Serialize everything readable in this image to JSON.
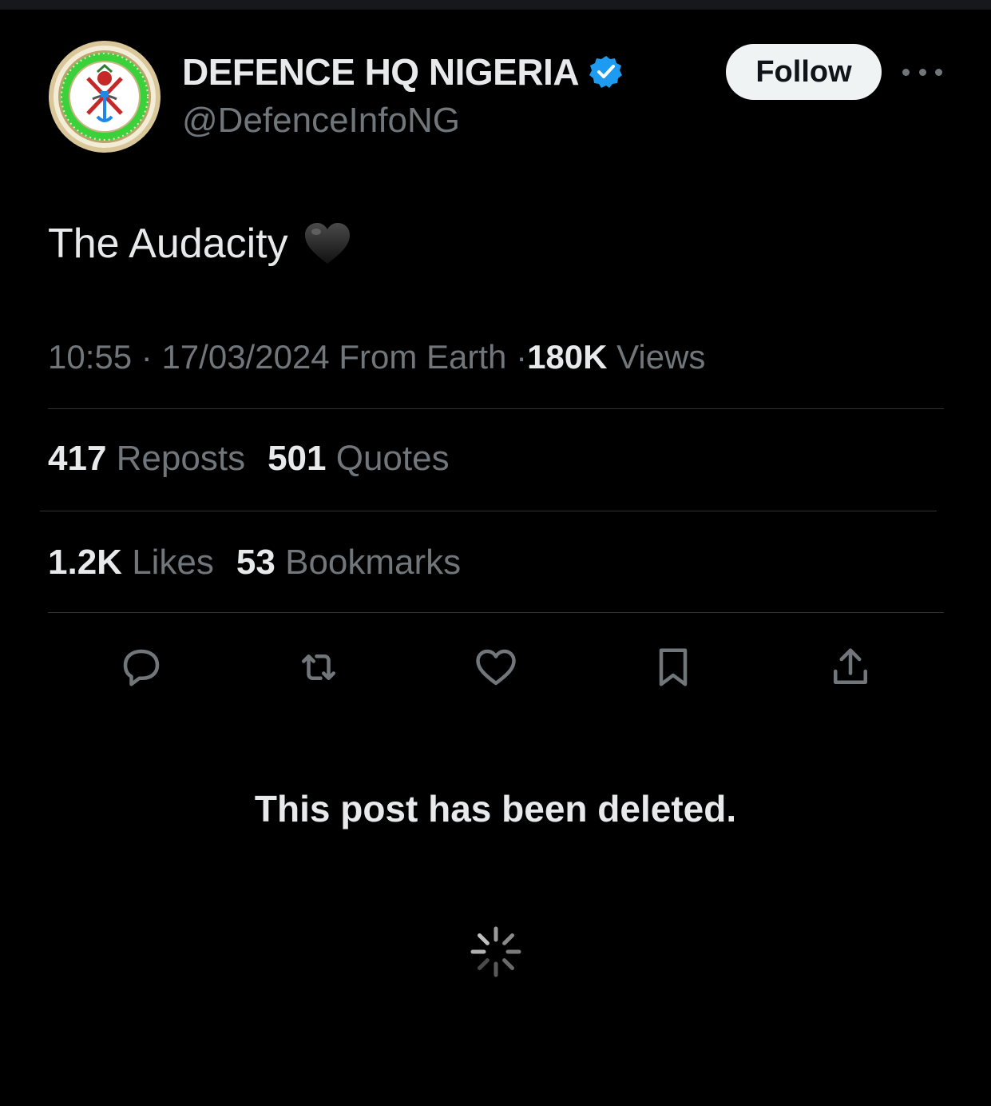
{
  "header": {
    "display_name": "DEFENCE HQ NIGERIA",
    "handle": "@DefenceInfoNG",
    "follow_label": "Follow",
    "verified_icon": "verified-badge-icon",
    "more_icon": "more-options-icon"
  },
  "post": {
    "text": "The Audacity",
    "emoji": "black-heart"
  },
  "meta": {
    "time": "10:55",
    "separator": "·",
    "date": "17/03/2024",
    "source": "From Earth",
    "views_count": "180K",
    "views_label": "Views"
  },
  "stats": {
    "reposts_count": "417",
    "reposts_label": "Reposts",
    "quotes_count": "501",
    "quotes_label": "Quotes",
    "likes_count": "1.2K",
    "likes_label": "Likes",
    "bookmarks_count": "53",
    "bookmarks_label": "Bookmarks"
  },
  "actions": [
    "reply-icon",
    "repost-icon",
    "like-icon",
    "bookmark-icon",
    "share-icon"
  ],
  "notice": "This post has been deleted.",
  "colors": {
    "background": "#000000",
    "primary_text": "#e7e9ea",
    "secondary_text": "#71767b",
    "divider": "#2f3336",
    "verified": "#1d9bf0",
    "follow_bg": "#eff3f4"
  }
}
